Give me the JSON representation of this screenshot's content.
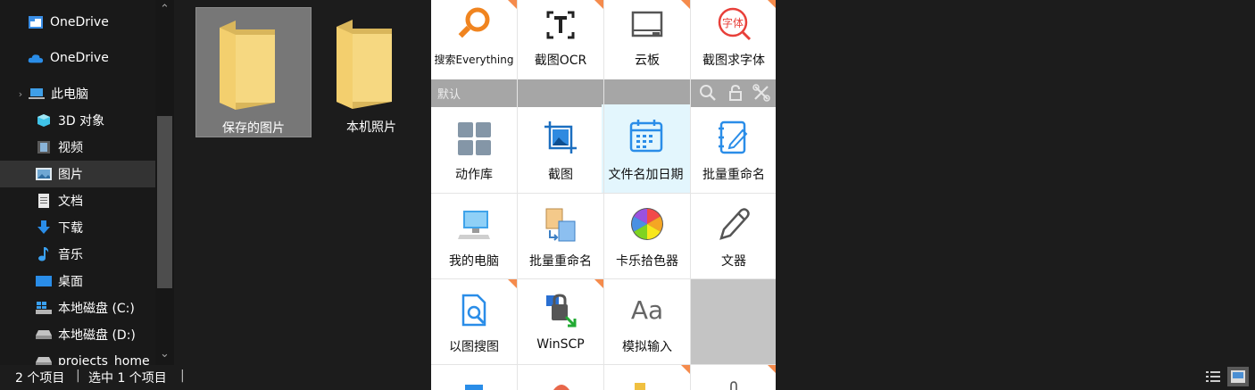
{
  "nav": {
    "items": [
      {
        "label": "OneDrive",
        "icon": "onedrive-folder-icon"
      },
      {
        "label": "OneDrive",
        "icon": "onedrive-cloud-icon"
      },
      {
        "label": "此电脑",
        "icon": "this-pc-icon"
      },
      {
        "label": "3D 对象",
        "icon": "3d-objects-icon"
      },
      {
        "label": "视频",
        "icon": "videos-icon"
      },
      {
        "label": "图片",
        "icon": "pictures-icon"
      },
      {
        "label": "文档",
        "icon": "documents-icon"
      },
      {
        "label": "下载",
        "icon": "downloads-icon"
      },
      {
        "label": "音乐",
        "icon": "music-icon"
      },
      {
        "label": "桌面",
        "icon": "desktop-icon"
      },
      {
        "label": "本地磁盘 (C:)",
        "icon": "windows-drive-icon"
      },
      {
        "label": "本地磁盘 (D:)",
        "icon": "drive-icon"
      },
      {
        "label": "projects_home",
        "icon": "network-drive-icon"
      }
    ],
    "selected": "图片"
  },
  "files": {
    "items": [
      {
        "label": "保存的图片",
        "icon": "folder-icon",
        "selected": true
      },
      {
        "label": "本机照片",
        "icon": "folder-icon",
        "selected": false
      }
    ]
  },
  "status": {
    "count": "2 个项目",
    "selected": "选中 1 个项目",
    "sep": "|"
  },
  "panel": {
    "top_row": [
      {
        "label": "搜索Everything",
        "icon": "search-everything-icon"
      },
      {
        "label": "截图OCR",
        "icon": "ocr-icon"
      },
      {
        "label": "云板",
        "icon": "cloud-board-icon"
      },
      {
        "label": "截图求字体",
        "icon": "font-finder-icon"
      }
    ],
    "group": {
      "name": "默认",
      "icons": [
        "search-icon",
        "lock-icon",
        "tools-icon"
      ]
    },
    "rows": [
      [
        {
          "label": "动作库",
          "icon": "action-library-icon"
        },
        {
          "label": "截图",
          "icon": "screenshot-icon"
        },
        {
          "label": "文件名加日期",
          "icon": "calendar-icon"
        },
        {
          "label": "批量重命名",
          "icon": "notebook-edit-icon"
        }
      ],
      [
        {
          "label": "我的电脑",
          "icon": "computer-icon"
        },
        {
          "label": "批量重命名",
          "icon": "batch-rename-icon"
        },
        {
          "label": "卡乐拾色器",
          "icon": "color-picker-icon"
        },
        {
          "label": "文器",
          "icon": "pen-icon"
        }
      ],
      [
        {
          "label": "以图搜图",
          "icon": "image-search-icon"
        },
        {
          "label": "WinSCP",
          "icon": "winscp-icon"
        },
        {
          "label": "模拟输入",
          "icon": "text-input-icon"
        },
        {
          "label": "",
          "icon": ""
        }
      ]
    ],
    "colors": {
      "accent": "#f58b4c",
      "highlight": "#e3f6fd",
      "blue": "#1c8ae6"
    }
  }
}
